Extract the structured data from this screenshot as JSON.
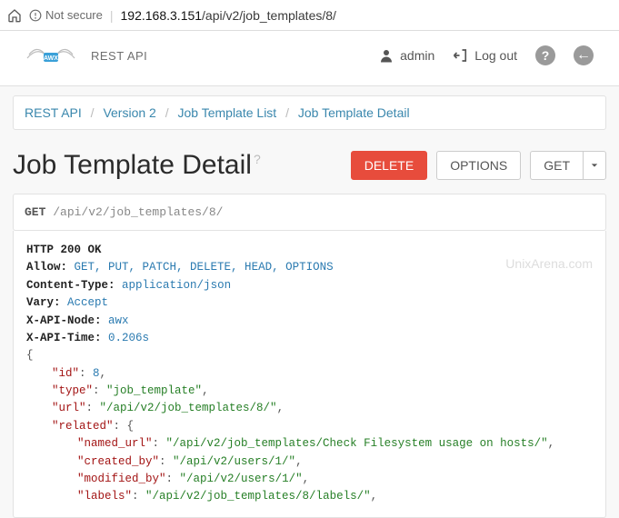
{
  "address_bar": {
    "security_text": "Not secure",
    "ip": "192.168.3.151",
    "path": "/api/v2/job_templates/8/"
  },
  "navbar": {
    "brand": "REST API",
    "user": "admin",
    "logout": "Log out"
  },
  "breadcrumb": {
    "items": [
      "REST API",
      "Version 2",
      "Job Template List",
      "Job Template Detail"
    ]
  },
  "title": "Job Template Detail",
  "buttons": {
    "delete": "DELETE",
    "options": "OPTIONS",
    "get": "GET"
  },
  "request": {
    "method": "GET",
    "path": "/api/v2/job_templates/8/"
  },
  "response": {
    "status": "HTTP 200 OK",
    "headers": {
      "allow_key": "Allow:",
      "allow_val": "GET, PUT, PATCH, DELETE, HEAD, OPTIONS",
      "ct_key": "Content-Type:",
      "ct_val": "application/json",
      "vary_key": "Vary:",
      "vary_val": "Accept",
      "node_key": "X-API-Node:",
      "node_val": "awx",
      "time_key": "X-API-Time:",
      "time_val": "0.206s"
    },
    "body": {
      "id_key": "\"id\"",
      "id_val": "8",
      "type_key": "\"type\"",
      "type_val": "\"job_template\"",
      "url_key": "\"url\"",
      "url_val": "\"/api/v2/job_templates/8/\"",
      "related_key": "\"related\"",
      "named_url_key": "\"named_url\"",
      "named_url_val": "\"/api/v2/job_templates/Check Filesystem usage on hosts/\"",
      "created_by_key": "\"created_by\"",
      "created_by_val": "\"/api/v2/users/1/\"",
      "modified_by_key": "\"modified_by\"",
      "modified_by_val": "\"/api/v2/users/1/\"",
      "labels_key": "\"labels\"",
      "labels_val": "\"/api/v2/job_templates/8/labels/\""
    }
  },
  "watermark": "UnixArena.com"
}
